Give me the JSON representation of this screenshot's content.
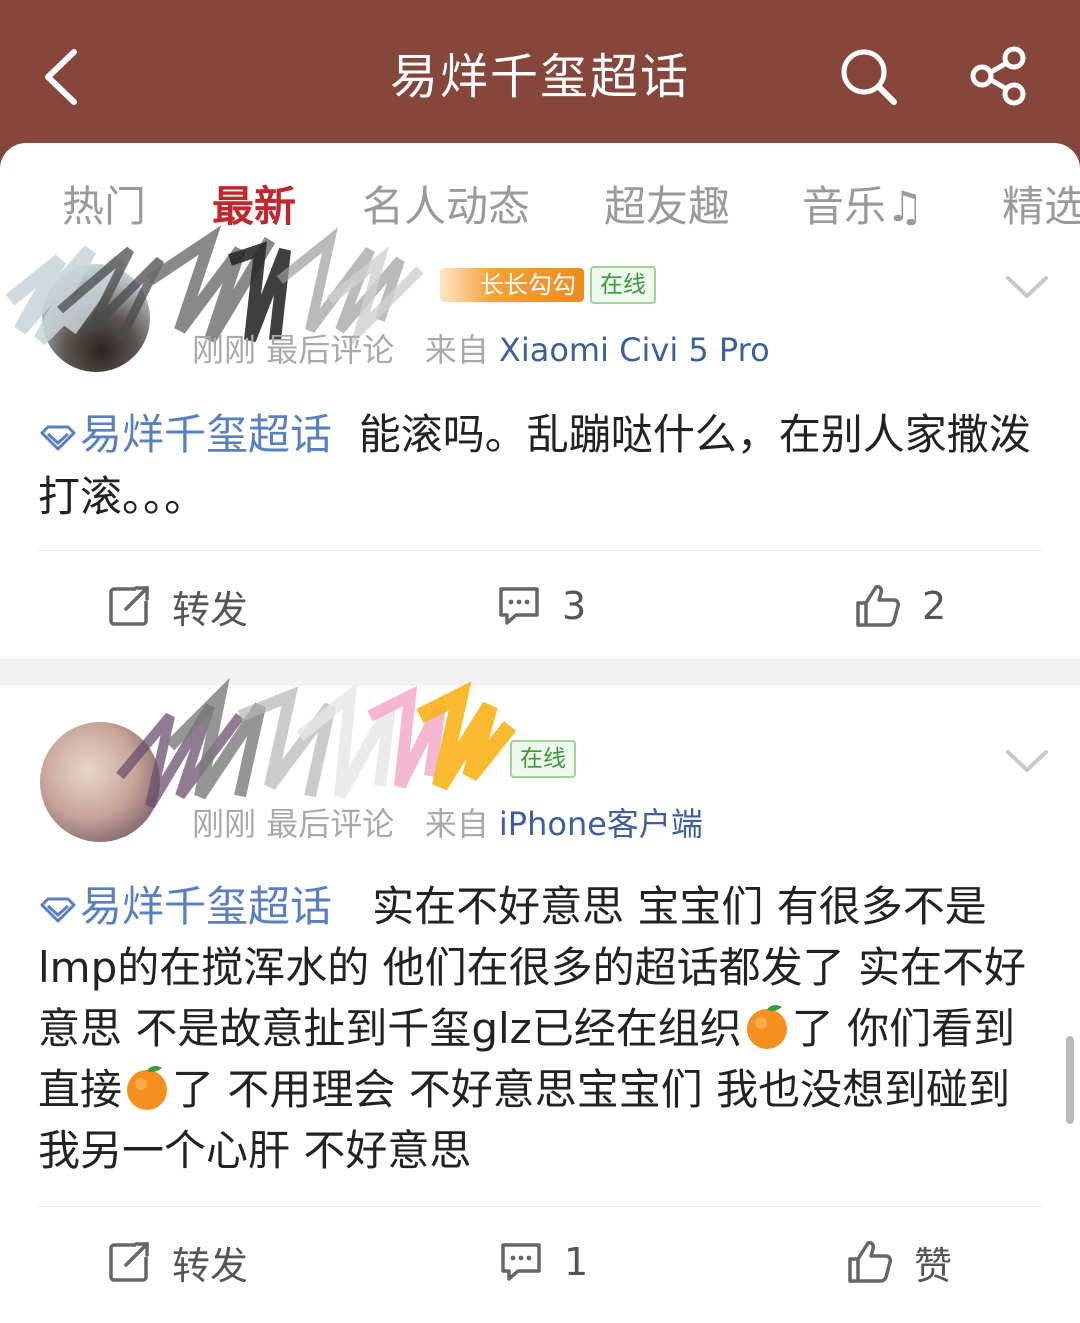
{
  "header": {
    "title": "易烊千玺超话",
    "icons": {
      "back": "back-chevron-icon",
      "search": "search-icon",
      "share": "share-icon"
    }
  },
  "tabs": [
    {
      "label": "热门",
      "active": false
    },
    {
      "label": "最新",
      "active": true
    },
    {
      "label": "名人动态",
      "active": false
    },
    {
      "label": "超友趣",
      "active": false
    },
    {
      "label": "音乐♫",
      "active": false
    },
    {
      "label": "精选",
      "active": false
    }
  ],
  "posts": [
    {
      "level_badge": "长长勾勾",
      "online_badge": "在线",
      "time": "刚刚",
      "last_comment": "最后评论",
      "from_prefix": "来自",
      "source": "Xiaomi Civi 5 Pro",
      "topic": "易烊千玺超话",
      "text": "能滚吗。乱蹦哒什么，在别人家撒泼打滚。。。",
      "actions": {
        "repost": "转发",
        "comments": "3",
        "likes": "2"
      }
    },
    {
      "online_badge": "在线",
      "time": "刚刚",
      "last_comment": "最后评论",
      "from_prefix": "来自",
      "source": "iPhone客户端",
      "topic": "易烊千玺超话",
      "text_1": "实在不好意思 宝宝们 有很多不是lmp的在搅浑水的 他们在很多的超话都发了 实在不好意思 不是故意扯到千玺glz已经在组织",
      "text_2": "了 你们看到直接",
      "text_3": "了 不用理会 不好意思宝宝们 我也没想到碰到我另一个心肝 不好意思",
      "actions": {
        "repost": "转发",
        "comments": "1",
        "likes": "赞"
      }
    }
  ],
  "colors": {
    "header_bg": "#86463b",
    "active_tab": "#c0282e",
    "topic_link": "#5a7fc0",
    "source_link": "#3f5f9a",
    "online_green": "#3a9a3a"
  }
}
